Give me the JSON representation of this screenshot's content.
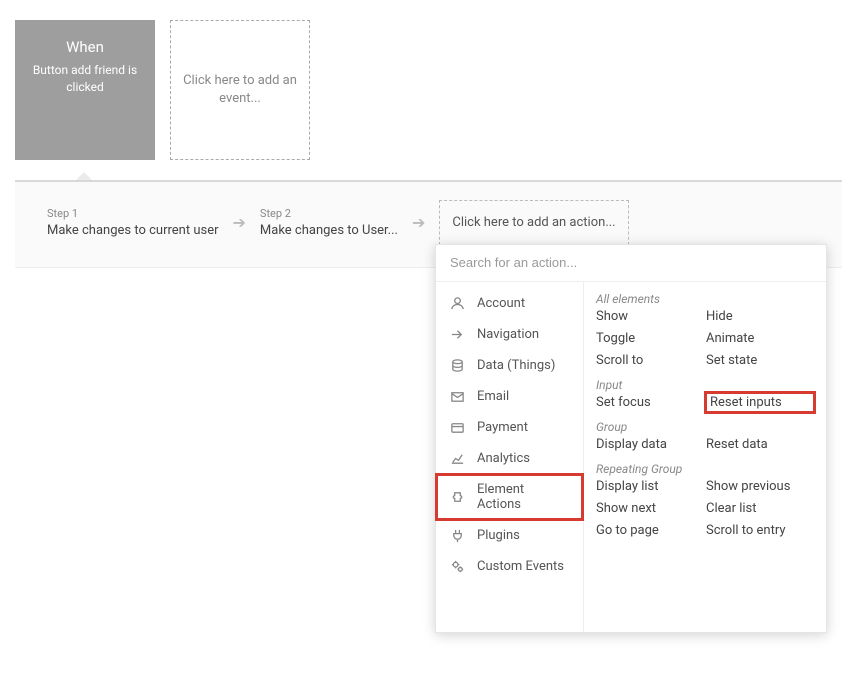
{
  "event": {
    "title": "When",
    "description": "Button add friend is clicked"
  },
  "empty_event": {
    "label": "Click here to add an event..."
  },
  "steps": [
    {
      "num": "Step 1",
      "label": "Make changes to current user"
    },
    {
      "num": "Step 2",
      "label": "Make changes to User..."
    }
  ],
  "add_action": {
    "label": "Click here to add an action..."
  },
  "picker": {
    "search_placeholder": "Search for an action...",
    "categories": [
      {
        "id": "account",
        "label": "Account",
        "icon": "user"
      },
      {
        "id": "navigation",
        "label": "Navigation",
        "icon": "share"
      },
      {
        "id": "data",
        "label": "Data (Things)",
        "icon": "database"
      },
      {
        "id": "email",
        "label": "Email",
        "icon": "mail"
      },
      {
        "id": "payment",
        "label": "Payment",
        "icon": "card"
      },
      {
        "id": "analytics",
        "label": "Analytics",
        "icon": "chart"
      },
      {
        "id": "element",
        "label": "Element Actions",
        "icon": "puzzle",
        "highlighted": true
      },
      {
        "id": "plugins",
        "label": "Plugins",
        "icon": "plug"
      },
      {
        "id": "custom",
        "label": "Custom Events",
        "icon": "gears"
      }
    ],
    "groups": [
      {
        "header": "All elements",
        "actions": [
          {
            "label": "Show"
          },
          {
            "label": "Hide"
          },
          {
            "label": "Toggle"
          },
          {
            "label": "Animate"
          },
          {
            "label": "Scroll to"
          },
          {
            "label": "Set state"
          }
        ]
      },
      {
        "header": "Input",
        "actions": [
          {
            "label": "Set focus"
          },
          {
            "label": "Reset inputs",
            "highlighted": true
          }
        ]
      },
      {
        "header": "Group",
        "actions": [
          {
            "label": "Display data"
          },
          {
            "label": "Reset data"
          }
        ]
      },
      {
        "header": "Repeating Group",
        "actions": [
          {
            "label": "Display list"
          },
          {
            "label": "Show previous"
          },
          {
            "label": "Show next"
          },
          {
            "label": "Clear list"
          },
          {
            "label": "Go to page"
          },
          {
            "label": "Scroll to entry"
          }
        ]
      }
    ]
  }
}
